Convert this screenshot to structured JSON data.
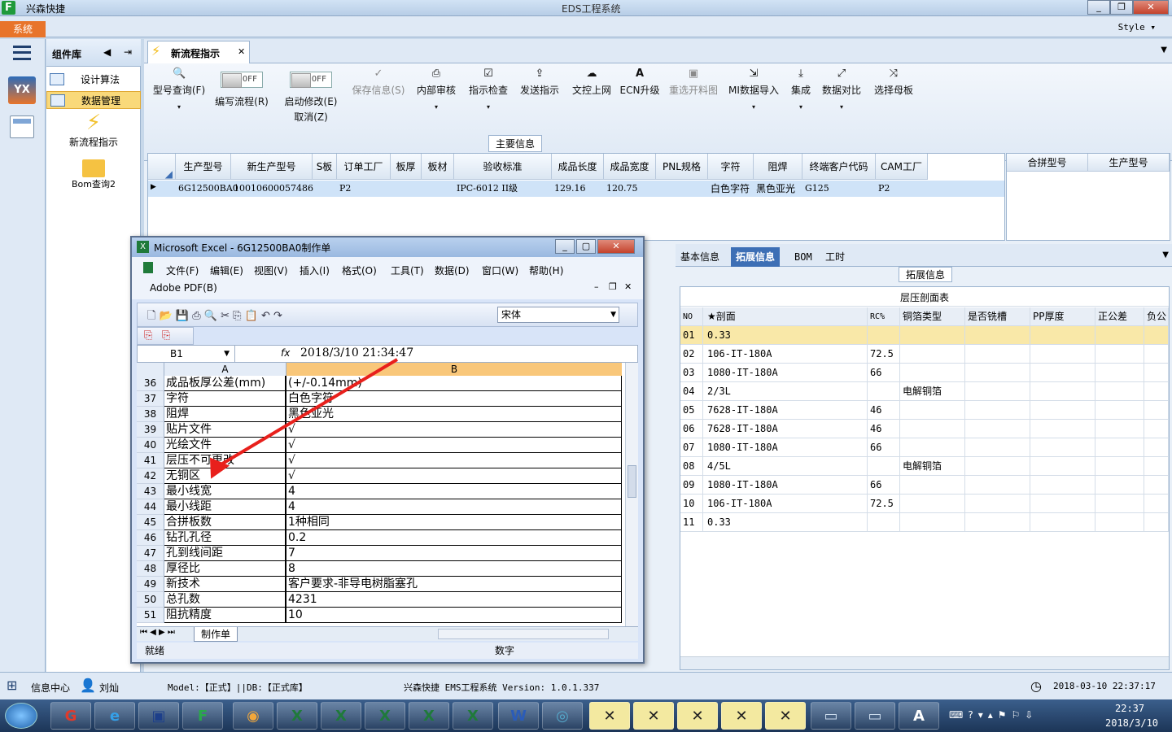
{
  "titlebar": {
    "app_name": "兴森快捷",
    "window_title": "EDS工程系统"
  },
  "menubar": {
    "system": "系统",
    "style": "Style"
  },
  "left_panel": {
    "header": "组件库",
    "items": [
      {
        "label": "设计算法"
      },
      {
        "label": "数据管理"
      }
    ],
    "shortcuts": [
      {
        "label": "新流程指示"
      },
      {
        "label": "Bom查询2"
      }
    ]
  },
  "tab": {
    "label": "新流程指示"
  },
  "ribbon": {
    "buttons": [
      {
        "label": "型号查询(F)"
      },
      {
        "label": "编写流程(R)",
        "toggle": "OFF"
      },
      {
        "label": "启动修改(E)",
        "sub": "取消(Z)",
        "toggle": "OFF"
      },
      {
        "label": "保存信息(S)"
      },
      {
        "label": "内部审核"
      },
      {
        "label": "指示检查"
      },
      {
        "label": "发送指示"
      },
      {
        "label": "文控上网"
      },
      {
        "label": "ECN升级"
      },
      {
        "label": "重选开料图"
      },
      {
        "label": "MI数据导入"
      },
      {
        "label": "集成"
      },
      {
        "label": "数据对比"
      },
      {
        "label": "选择母板"
      }
    ]
  },
  "main_info": {
    "section_title": "主要信息",
    "columns": [
      "生产型号",
      "新生产型号",
      "S板",
      "订单工厂",
      "板厚",
      "板材",
      "验收标准",
      "成品长度",
      "成品宽度",
      "PNL规格",
      "字符",
      "阻焊",
      "终端客户代码",
      "CAM工厂"
    ],
    "row": [
      "6G12500BA0",
      "10010600057486",
      "",
      "P2",
      "",
      "",
      "IPC-6012 II级",
      "129.16",
      "120.75",
      "",
      "白色字符",
      "黑色亚光",
      "G125",
      "P2"
    ],
    "side_columns": [
      "合拼型号",
      "生产型号"
    ]
  },
  "right_panel": {
    "tabs": [
      "基本信息",
      "拓展信息",
      "BOM",
      "工时"
    ],
    "active_tab": "拓展信息",
    "section_title": "拓展信息",
    "table_title": "层压剖面表",
    "columns": [
      "NO",
      "★剖面",
      "RC%",
      "铜箔类型",
      "是否铣槽",
      "PP厚度",
      "正公差",
      "负公"
    ],
    "rows": [
      [
        "01",
        "0.33",
        "",
        ""
      ],
      [
        "02",
        "106-IT-180A",
        "72.5",
        ""
      ],
      [
        "03",
        "1080-IT-180A",
        "66",
        ""
      ],
      [
        "04",
        "2/3L",
        "",
        "电解铜箔"
      ],
      [
        "05",
        "7628-IT-180A",
        "46",
        ""
      ],
      [
        "06",
        "7628-IT-180A",
        "46",
        ""
      ],
      [
        "07",
        "1080-IT-180A",
        "66",
        ""
      ],
      [
        "08",
        "4/5L",
        "",
        "电解铜箔"
      ],
      [
        "09",
        "1080-IT-180A",
        "66",
        ""
      ],
      [
        "10",
        "106-IT-180A",
        "72.5",
        ""
      ],
      [
        "11",
        "0.33",
        "",
        ""
      ]
    ]
  },
  "excel": {
    "title": "Microsoft Excel - 6G12500BA0制作单",
    "menu": [
      "文件(F)",
      "编辑(E)",
      "视图(V)",
      "插入(I)",
      "格式(O)",
      "工具(T)",
      "数据(D)",
      "窗口(W)",
      "帮助(H)",
      "Adobe PDF(B)"
    ],
    "font": "宋体",
    "name_box": "B1",
    "formula": "2018/3/10  21:34:47",
    "col_a": "A",
    "col_b": "B",
    "rows": [
      {
        "n": "36",
        "a": "成品板厚公差(mm)",
        "b": "(+/-0.14mm)"
      },
      {
        "n": "37",
        "a": "字符",
        "b": "白色字符"
      },
      {
        "n": "38",
        "a": "阻焊",
        "b": "黑色亚光"
      },
      {
        "n": "39",
        "a": "贴片文件",
        "b": "√"
      },
      {
        "n": "40",
        "a": "光绘文件",
        "b": "√"
      },
      {
        "n": "41",
        "a": "层压不可更改",
        "b": "√"
      },
      {
        "n": "42",
        "a": "无铜区",
        "b": "√"
      },
      {
        "n": "43",
        "a": "最小线宽",
        "b": "4"
      },
      {
        "n": "44",
        "a": "最小线距",
        "b": "4"
      },
      {
        "n": "45",
        "a": "合拼板数",
        "b": "1种相同"
      },
      {
        "n": "46",
        "a": "钻孔孔径",
        "b": "0.2"
      },
      {
        "n": "47",
        "a": "孔到线间距",
        "b": "7"
      },
      {
        "n": "48",
        "a": "厚径比",
        "b": "8"
      },
      {
        "n": "49",
        "a": "新技术",
        "b": "客户要求-非导电树脂塞孔"
      },
      {
        "n": "50",
        "a": "总孔数",
        "b": "4231"
      },
      {
        "n": "51",
        "a": "阻抗精度",
        "b": "10"
      }
    ],
    "sheet_tab": "制作单",
    "status_left": "就绪",
    "status_right": "数字"
  },
  "statusbar": {
    "info_center": "信息中心",
    "user": "刘灿",
    "model": "Model:【正式】||DB:【正式库】",
    "version": "兴森快捷 EMS工程系统 Version: 1.0.1.337",
    "datetime": "2018-03-10 22:37:17"
  },
  "taskbar": {
    "time": "22:37",
    "date": "2018/3/10"
  },
  "colors": {
    "accent": "#3d6fb5",
    "system_orange": "#e8742a",
    "excel_header": "#f9c77a",
    "arrow": "#e8201c"
  }
}
